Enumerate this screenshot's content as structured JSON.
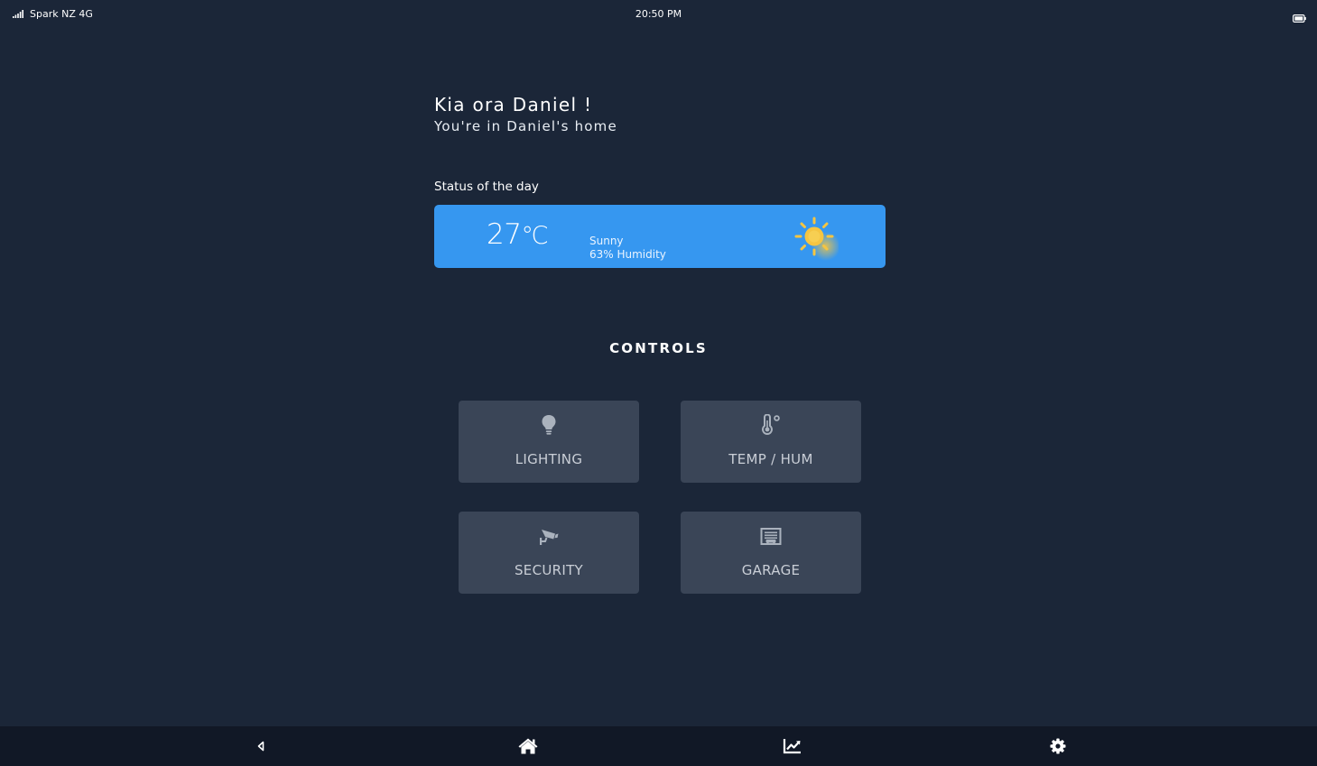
{
  "status_bar": {
    "carrier": "Spark NZ 4G",
    "time": "20:50 PM"
  },
  "greeting": {
    "title": "Kia ora Daniel !",
    "subtitle": "You're in Daniel's home"
  },
  "weather": {
    "section_label": "Status of the day",
    "temperature": "27",
    "unit": "℃",
    "condition": "Sunny",
    "humidity": "63% Humidity",
    "icon": "sun-icon",
    "card_color": "#3697f0"
  },
  "controls": {
    "title": "CONTROLS",
    "items": [
      {
        "label": "LIGHTING",
        "icon": "lightbulb-icon"
      },
      {
        "label": "TEMP / HUM",
        "icon": "thermometer-icon"
      },
      {
        "label": "SECURITY",
        "icon": "security-camera-icon"
      },
      {
        "label": "GARAGE",
        "icon": "garage-icon"
      }
    ]
  },
  "nav": {
    "items": [
      {
        "icon": "back-icon"
      },
      {
        "icon": "home-icon"
      },
      {
        "icon": "chart-icon"
      },
      {
        "icon": "settings-gear-icon"
      }
    ]
  },
  "colors": {
    "background": "#1b2638",
    "tile": "#3a4557",
    "navbar": "#111826",
    "accent": "#3697f0",
    "sun": "#f5c542"
  }
}
